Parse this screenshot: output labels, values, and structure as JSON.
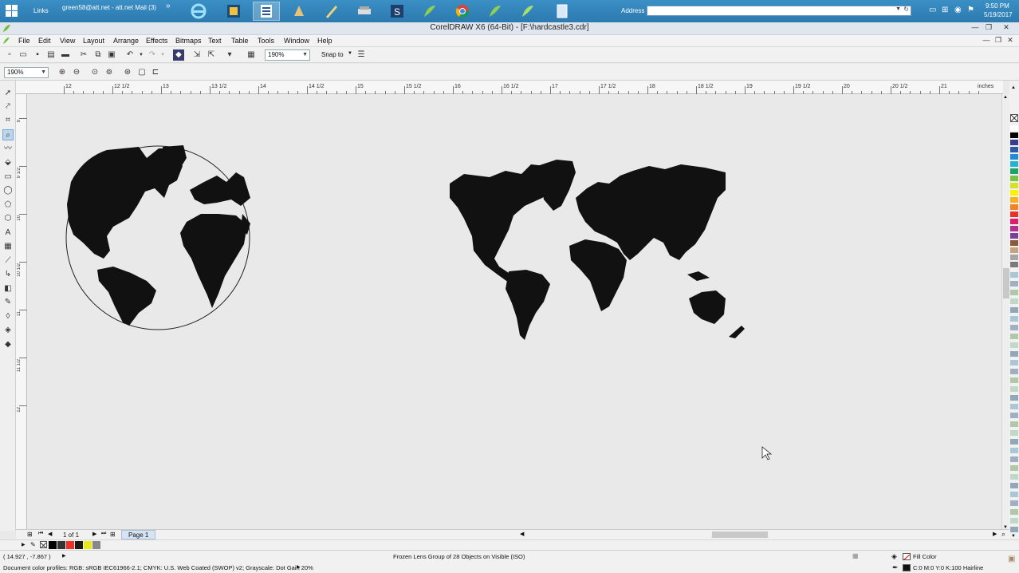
{
  "taskbar": {
    "links_label": "Links",
    "mail_item": "green58@att.net - att.net Mail (3)",
    "overflow": "»",
    "address_label": "Address",
    "address_value": "",
    "clock_time": "9:50 PM",
    "clock_date": "5/19/2017"
  },
  "window": {
    "title": "CorelDRAW X6 (64-Bit) - [F:\\hardcastle3.cdr]"
  },
  "menu": {
    "items": [
      "File",
      "Edit",
      "View",
      "Layout",
      "Arrange",
      "Effects",
      "Bitmaps",
      "Text",
      "Table",
      "Tools",
      "Window",
      "Help"
    ]
  },
  "toolbar": {
    "zoom_main": "190%",
    "snap_to": "Snap to",
    "zoom_small": "190%"
  },
  "rulers": {
    "top_labels": [
      "12",
      "12 1/2",
      "13",
      "13 1/2",
      "14",
      "14 1/2",
      "15",
      "15 1/2",
      "16",
      "16 1/2",
      "17",
      "17 1/2",
      "18",
      "18 1/2",
      "19",
      "19 1/2",
      "20",
      "20 1/2",
      "21"
    ],
    "unit": "inches",
    "left_labels": [
      "9",
      "9 1/2",
      "10",
      "10 1/2",
      "11",
      "11 1/2",
      "12"
    ]
  },
  "pages": {
    "counter": "1 of 1",
    "tab_label": "Page 1"
  },
  "status": {
    "coords": "( 14.927 , -7.867 )",
    "object_info": "Frozen Lens Group of 28 Objects on Visible (ISO)",
    "fill_label": "Fill Color",
    "color_profiles": "Document color profiles: RGB: sRGB IEC61966-2.1; CMYK: U.S. Web Coated (SWOP) v2; Grayscale: Dot Gain 20%",
    "outline_info": "C:0 M:0 Y:0 K:100  Hairline"
  },
  "palette": {
    "colors": [
      "#ffffff",
      "#000000",
      "#3b3b8f",
      "#2a5caa",
      "#1f8dd6",
      "#22b5d3",
      "#1aa66a",
      "#7cc242",
      "#d6e21d",
      "#fdf200",
      "#f7b21e",
      "#f4821f",
      "#ee3124",
      "#e31b6d",
      "#b52e8f",
      "#7f3f98",
      "#8b5a3c",
      "#c8a27a",
      "#a6a6a6",
      "#7a7a7a"
    ],
    "doc_colors": [
      "#000000",
      "#333333",
      "#ee3124",
      "#1a1a1a",
      "#e8e819",
      "#888888"
    ]
  }
}
